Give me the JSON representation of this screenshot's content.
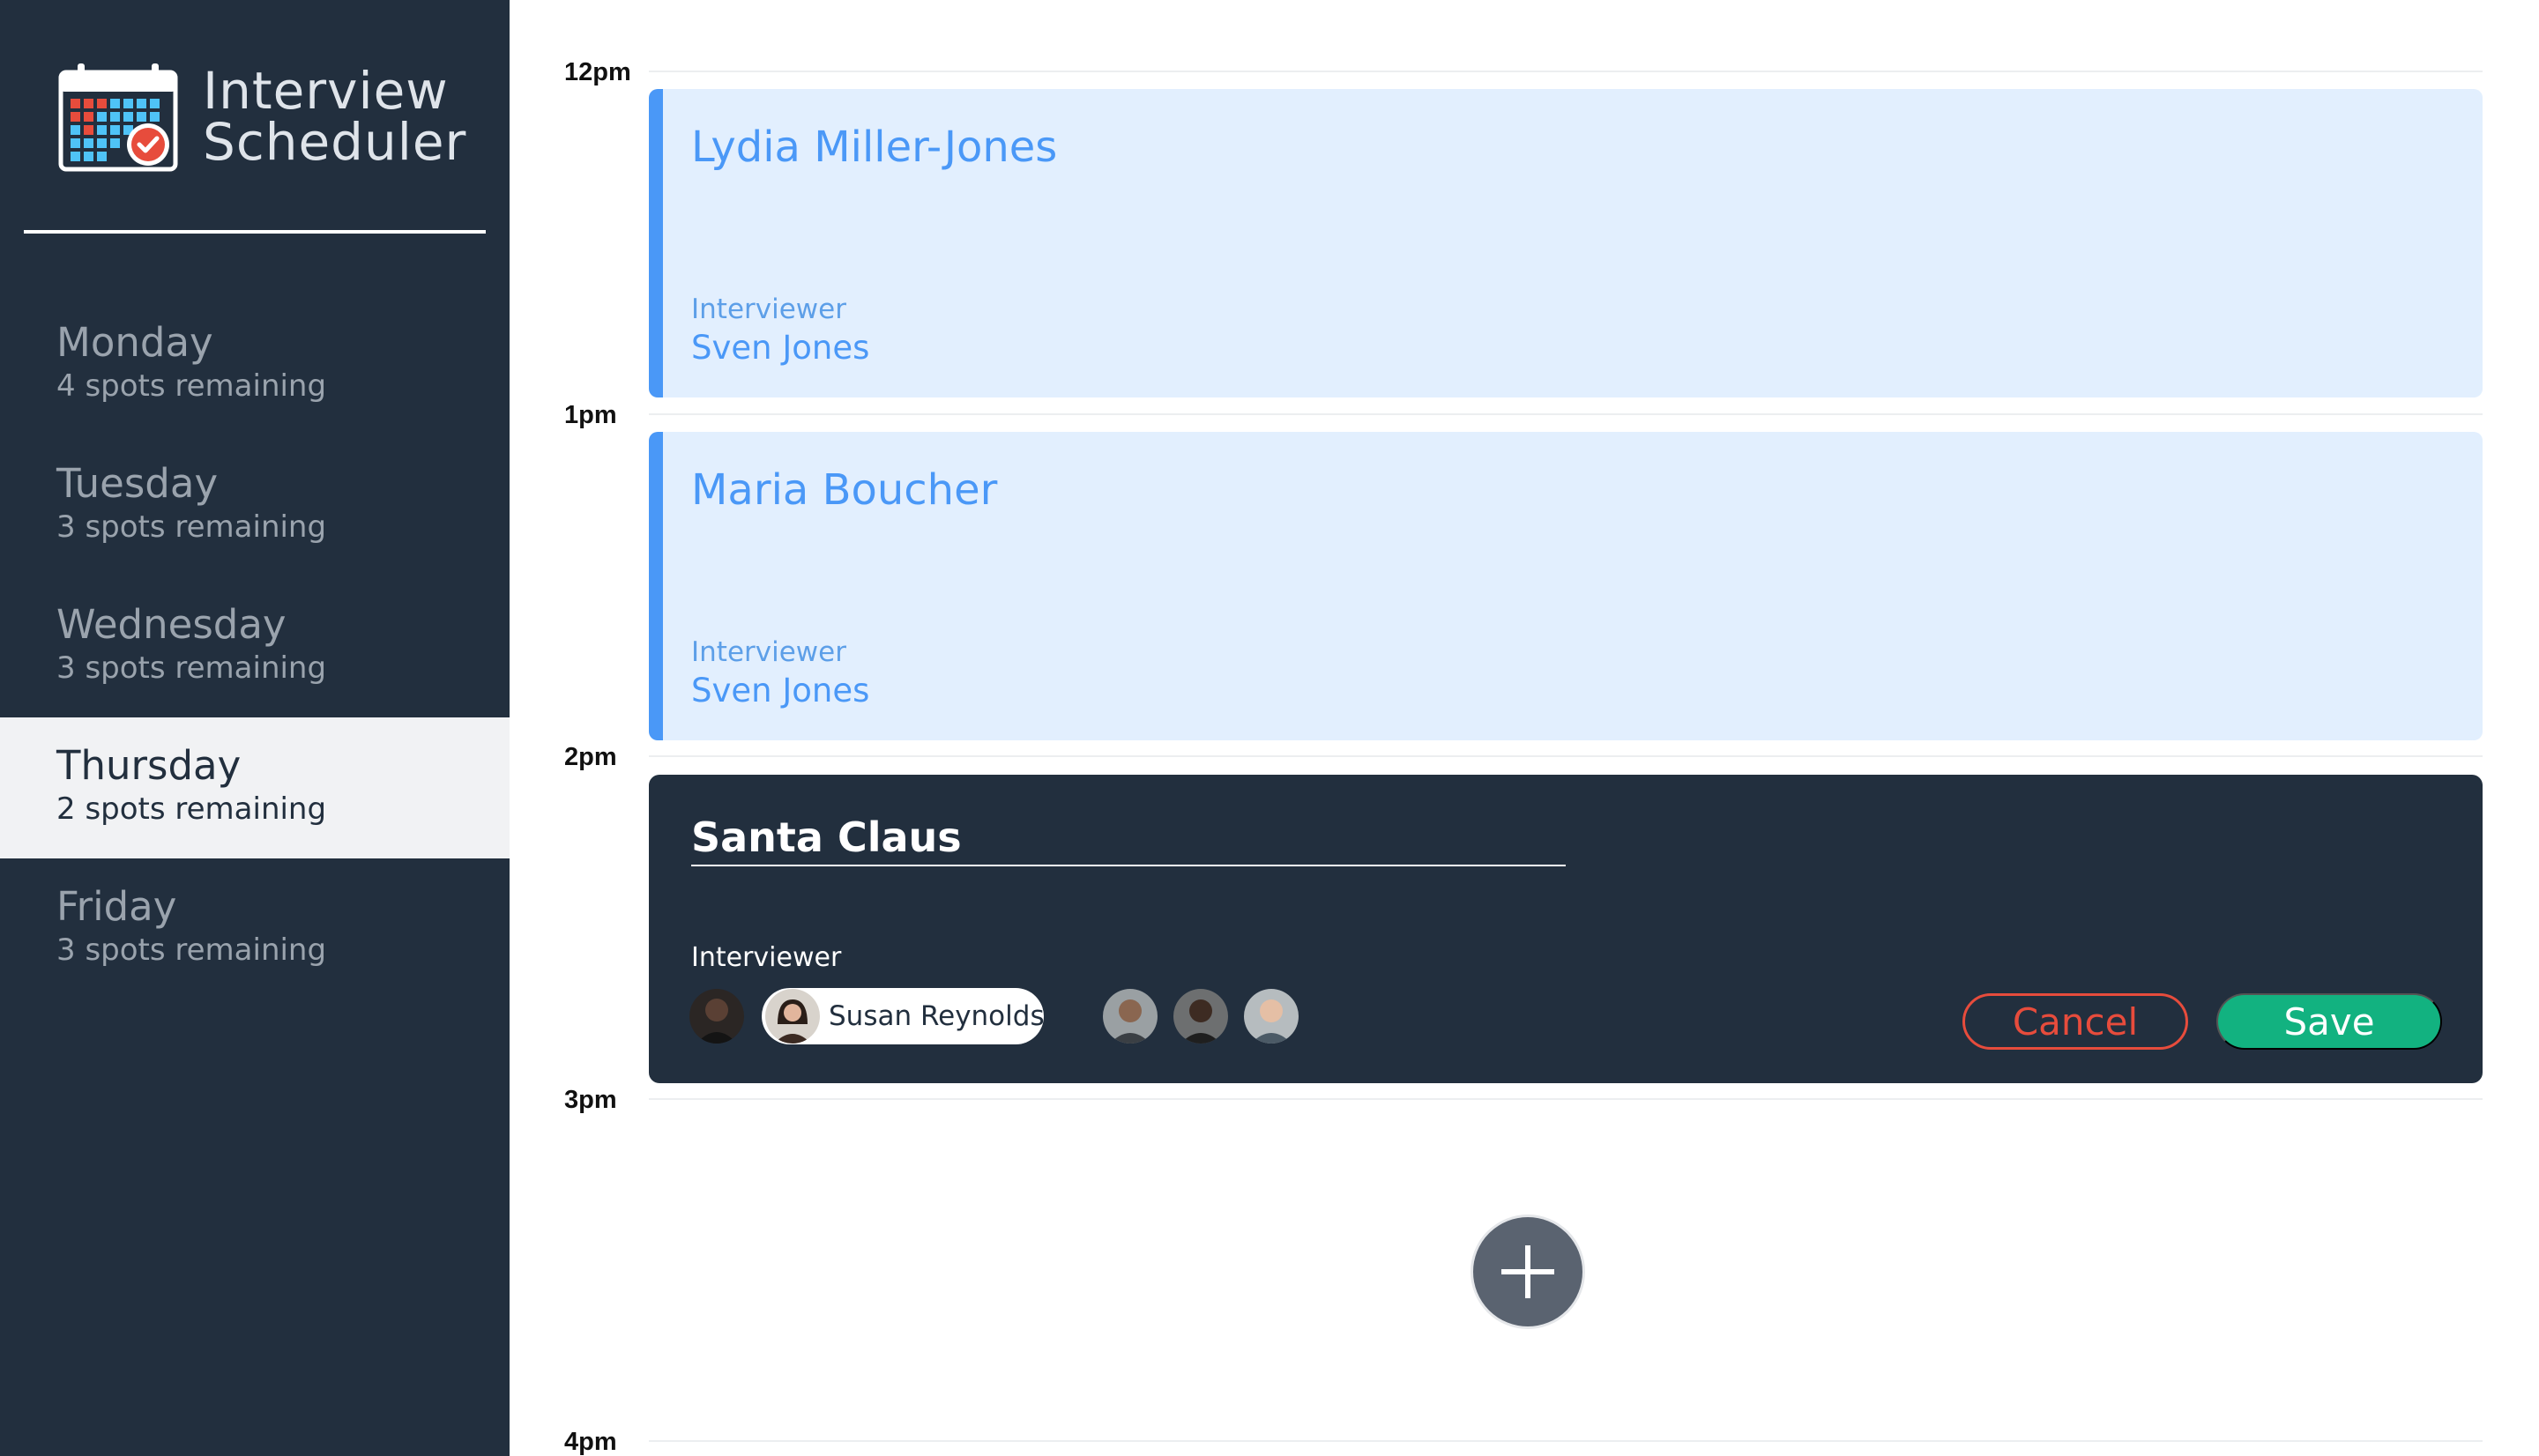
{
  "app": {
    "title_line1": "Interview",
    "title_line2": "Scheduler",
    "logo_icon": "calendar-check-icon"
  },
  "days": [
    {
      "name": "Monday",
      "spots": "4 spots remaining",
      "selected": false
    },
    {
      "name": "Tuesday",
      "spots": "3 spots remaining",
      "selected": false
    },
    {
      "name": "Wednesday",
      "spots": "3 spots remaining",
      "selected": false
    },
    {
      "name": "Thursday",
      "spots": "2 spots remaining",
      "selected": true
    },
    {
      "name": "Friday",
      "spots": "3 spots remaining",
      "selected": false
    }
  ],
  "schedule": {
    "times": [
      "12pm",
      "1pm",
      "2pm",
      "3pm",
      "4pm"
    ],
    "appointments": [
      {
        "time": "12pm",
        "student": "Lydia Miller-Jones",
        "interviewer_label": "Interviewer",
        "interviewer": "Sven Jones"
      },
      {
        "time": "1pm",
        "student": "Maria Boucher",
        "interviewer_label": "Interviewer",
        "interviewer": "Sven Jones"
      }
    ],
    "editor": {
      "time": "2pm",
      "student_value": "Santa Claus",
      "interviewer_label": "Interviewer",
      "selected_interviewer": "Susan Reynolds",
      "cancel_label": "Cancel",
      "save_label": "Save"
    },
    "add_icon": "plus-icon"
  },
  "colors": {
    "sidebar_bg": "#222f3e",
    "appointment_bg": "#e2effe",
    "appointment_accent": "#4a98f7",
    "cancel": "#e74c3c",
    "save": "#12b280"
  }
}
